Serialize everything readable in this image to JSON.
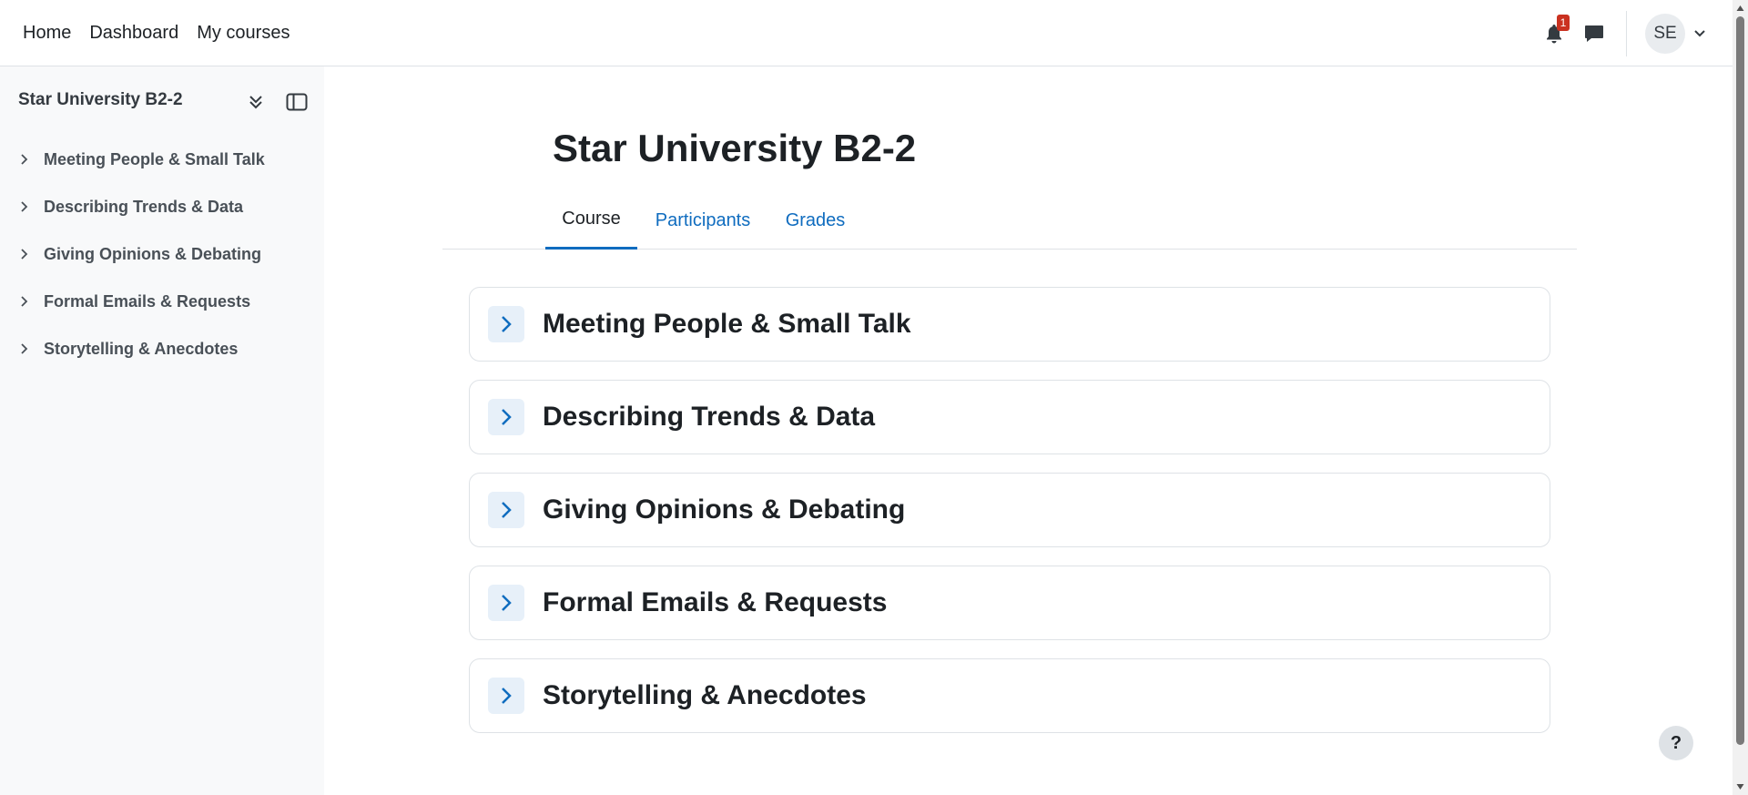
{
  "navbar": {
    "links": [
      "Home",
      "Dashboard",
      "My courses"
    ],
    "notification_count": "1",
    "avatar_initials": "SE"
  },
  "sidebar": {
    "title": "Star University B2-2",
    "items": [
      {
        "label": "Meeting People & Small Talk"
      },
      {
        "label": "Describing Trends & Data"
      },
      {
        "label": "Giving Opinions & Debating"
      },
      {
        "label": "Formal Emails & Requests"
      },
      {
        "label": "Storytelling & Anecdotes"
      }
    ]
  },
  "main": {
    "title": "Star University B2-2",
    "tabs": [
      {
        "label": "Course",
        "active": true
      },
      {
        "label": "Participants",
        "active": false
      },
      {
        "label": "Grades",
        "active": false
      }
    ],
    "sections": [
      {
        "title": "Meeting People & Small Talk"
      },
      {
        "title": "Describing Trends & Data"
      },
      {
        "title": "Giving Opinions & Debating"
      },
      {
        "title": "Formal Emails & Requests"
      },
      {
        "title": "Storytelling & Anecdotes"
      }
    ]
  },
  "help_label": "?",
  "colors": {
    "accent": "#0f6cbf",
    "sidebar_bg": "#f8f9fa",
    "badge": "#ca3120",
    "toggle_bg": "#e7f0f9"
  }
}
